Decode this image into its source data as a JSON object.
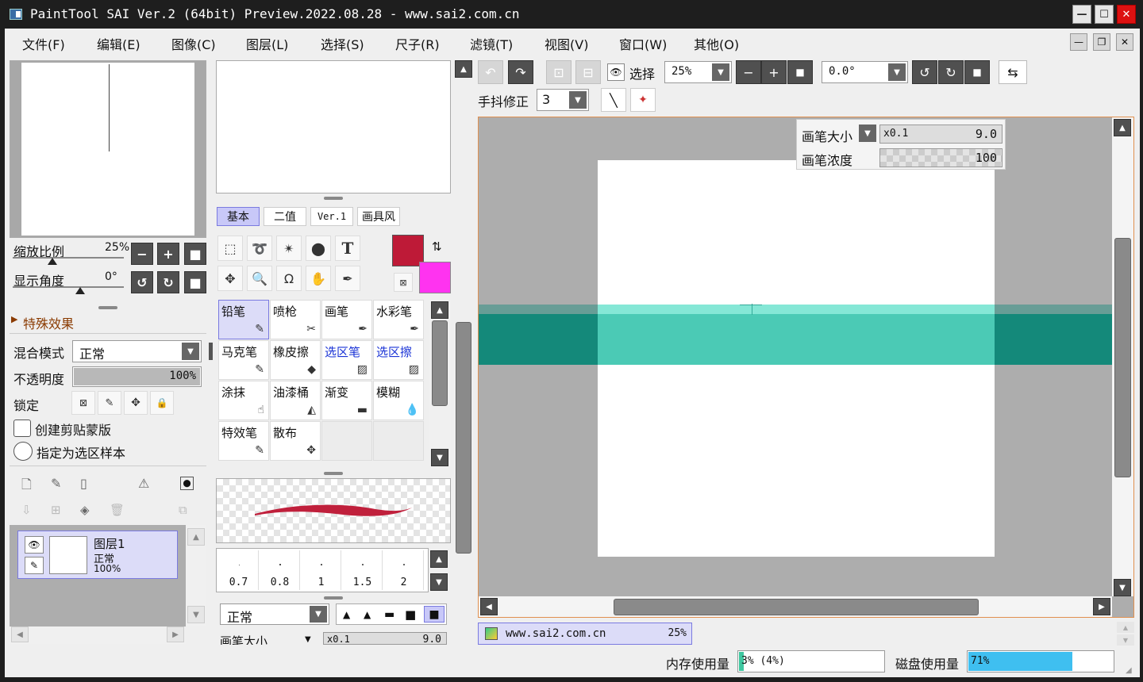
{
  "window": {
    "title": "PaintTool SAI Ver.2 (64bit) Preview.2022.08.28 - www.sai2.com.cn"
  },
  "menu": [
    "文件(F)",
    "编辑(E)",
    "图像(C)",
    "图层(L)",
    "选择(S)",
    "尺子(R)",
    "滤镜(T)",
    "视图(V)",
    "窗口(W)",
    "其他(O)"
  ],
  "navigator": {
    "zoom_label": "缩放比例",
    "zoom_value": "25%",
    "zoom_fraction": 0.1,
    "angle_label": "显示角度",
    "angle_value": "0°",
    "angle_fraction": 0.5
  },
  "effects": {
    "label": "特殊效果"
  },
  "layer_props": {
    "blend_label": "混合模式",
    "blend_value": "正常",
    "opacity_label": "不透明度",
    "opacity_value": "100%",
    "lock_label": "锁定",
    "clip_label": "创建剪贴蒙版",
    "sample_label": "指定为选区样本"
  },
  "layers": [
    {
      "name": "图层1",
      "mode": "正常",
      "opacity": "100%"
    }
  ],
  "tool_tabs": [
    "基本",
    "二值",
    "Ver.1",
    "画具风"
  ],
  "colors": {
    "primary": "#be1a37",
    "secondary": "#ff33f0",
    "stroke": "#c0203c",
    "accent_teal": "#14897a",
    "canvas_bg": "#adadad"
  },
  "brushes": [
    {
      "name": "铅笔",
      "icon": "pencil-icon",
      "glyph": "✎",
      "selected": true,
      "blue": false
    },
    {
      "name": "喷枪",
      "icon": "airbrush-icon",
      "glyph": "✂",
      "selected": false,
      "blue": false
    },
    {
      "name": "画笔",
      "icon": "brush-icon",
      "glyph": "✒",
      "selected": false,
      "blue": false
    },
    {
      "name": "水彩笔",
      "icon": "watercolor-icon",
      "glyph": "✒",
      "selected": false,
      "blue": false
    },
    {
      "name": "马克笔",
      "icon": "marker-icon",
      "glyph": "✎",
      "selected": false,
      "blue": false
    },
    {
      "name": "橡皮擦",
      "icon": "eraser-icon",
      "glyph": "◆",
      "selected": false,
      "blue": false
    },
    {
      "name": "选区笔",
      "icon": "selection-pen-icon",
      "glyph": "▨",
      "selected": false,
      "blue": true
    },
    {
      "name": "选区擦",
      "icon": "selection-eraser-icon",
      "glyph": "▨",
      "selected": false,
      "blue": true
    },
    {
      "name": "涂抹",
      "icon": "smudge-icon",
      "glyph": "☝",
      "selected": false,
      "blue": false
    },
    {
      "name": "油漆桶",
      "icon": "bucket-icon",
      "glyph": "◭",
      "selected": false,
      "blue": false
    },
    {
      "name": "渐变",
      "icon": "gradient-icon",
      "glyph": "▬",
      "selected": false,
      "blue": false
    },
    {
      "name": "模糊",
      "icon": "blur-icon",
      "glyph": "💧",
      "selected": false,
      "blue": false
    },
    {
      "name": "特效笔",
      "icon": "effect-pen-icon",
      "glyph": "✎",
      "selected": false,
      "blue": false
    },
    {
      "name": "散布",
      "icon": "scatter-icon",
      "glyph": "✥",
      "selected": false,
      "blue": false
    },
    {
      "name": "",
      "icon": "",
      "glyph": "",
      "selected": false,
      "blue": false
    },
    {
      "name": "",
      "icon": "",
      "glyph": "",
      "selected": false,
      "blue": false
    }
  ],
  "brush_sizes": [
    "0.7",
    "0.8",
    "1",
    "1.5",
    "2"
  ],
  "brush_mode": "正常",
  "brush_size": {
    "label": "画笔大小",
    "mult": "x0.1",
    "value": "9.0"
  },
  "toolbar": {
    "select_label": "选择",
    "zoom": "25%",
    "angle": "0.0°",
    "stabilizer_label": "手抖修正",
    "stabilizer_value": "3"
  },
  "overlay": {
    "size_label": "画笔大小",
    "size_mult": "x0.1",
    "size_value": "9.0",
    "density_label": "画笔浓度",
    "density_value": "100"
  },
  "doc_tab": {
    "name": "www.sai2.com.cn",
    "zoom": "25%"
  },
  "status": {
    "mem_label": "内存使用量",
    "mem_value": "3% (4%)",
    "mem_fraction": 0.03,
    "disk_label": "磁盘使用量",
    "disk_value": "71%",
    "disk_fraction": 0.71
  }
}
